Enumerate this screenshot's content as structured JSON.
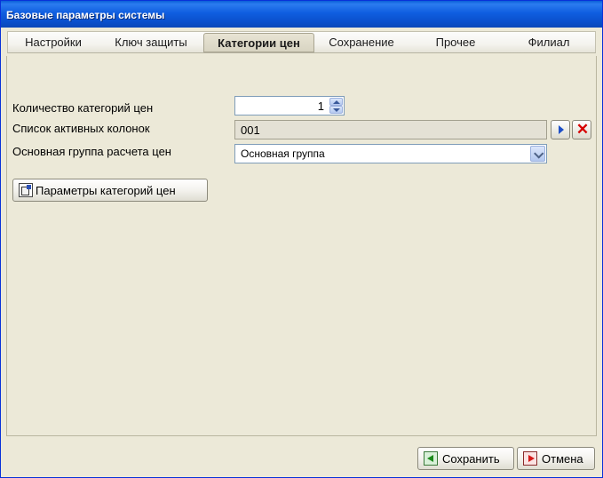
{
  "window": {
    "title": "Базовые параметры системы"
  },
  "tabs": [
    {
      "label": "Настройки",
      "active": false
    },
    {
      "label": "Ключ защиты",
      "active": false
    },
    {
      "label": "Категории цен",
      "active": true
    },
    {
      "label": "Сохранение",
      "active": false
    },
    {
      "label": "Прочее",
      "active": false
    },
    {
      "label": "Филиал",
      "active": false
    }
  ],
  "form": {
    "price_categories_count": {
      "label": "Количество категорий цен",
      "value": "1"
    },
    "active_columns": {
      "label": "Список активных колонок",
      "value": "001"
    },
    "main_price_group": {
      "label": "Основная группа расчета цен",
      "selected": "Основная группа"
    },
    "params_button_label": "Параметры категорий цен"
  },
  "footer": {
    "save_label": "Сохранить",
    "cancel_label": "Отмена"
  },
  "icons": {
    "next": "arrow-right-icon",
    "clear": "close-icon",
    "params": "settings-sheet-icon",
    "save": "save-icon",
    "cancel": "cancel-icon"
  },
  "colors": {
    "title_bar": "#0a4fcb",
    "window_bg": "#ece9d8",
    "clear_red": "#d60000",
    "next_blue": "#1d4fc7"
  }
}
